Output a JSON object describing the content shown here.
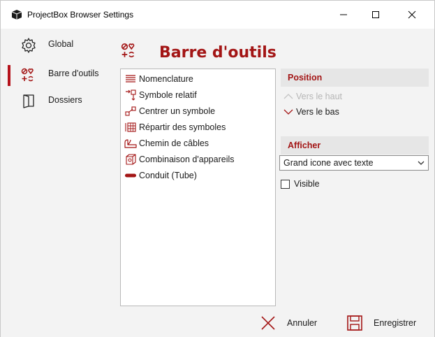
{
  "window": {
    "title": "ProjectBox Browser Settings",
    "min_glyph": "—",
    "max_glyph": "☐",
    "close_glyph": "✕"
  },
  "sidebar": {
    "items": [
      {
        "label": "Global",
        "icon": "gear-icon",
        "active": false
      },
      {
        "label": "Barre d'outils",
        "icon": "toolbar-icon",
        "active": true
      },
      {
        "label": "Dossiers",
        "icon": "folder-icon",
        "active": false
      }
    ]
  },
  "main": {
    "title": "Barre d'outils",
    "tools": [
      {
        "label": "Nomenclature",
        "icon": "list-icon"
      },
      {
        "label": "Symbole relatif",
        "icon": "relative-symbol-icon"
      },
      {
        "label": "Centrer un symbole",
        "icon": "center-symbol-icon"
      },
      {
        "label": "Répartir des symboles",
        "icon": "distribute-symbols-icon"
      },
      {
        "label": "Chemin de câbles",
        "icon": "cable-path-icon"
      },
      {
        "label": "Combinaison d'appareils",
        "icon": "device-combination-icon"
      },
      {
        "label": "Conduit (Tube)",
        "icon": "conduit-icon"
      }
    ],
    "position": {
      "header": "Position",
      "options": [
        {
          "label": "Vers le haut",
          "enabled": false,
          "icon": "chevron-up-icon"
        },
        {
          "label": "Vers le bas",
          "enabled": true,
          "icon": "chevron-down-icon"
        }
      ]
    },
    "display": {
      "header": "Afficher",
      "selected": "Grand icone avec texte",
      "visible_label": "Visible",
      "visible_checked": false
    }
  },
  "footer": {
    "cancel_label": "Annuler",
    "save_label": "Enregistrer"
  },
  "colors": {
    "accent": "#a31515",
    "active_bar": "#b5121b",
    "sidebar_bg": "#f3f3f3",
    "panel_header_bg": "#e6e6e6"
  }
}
